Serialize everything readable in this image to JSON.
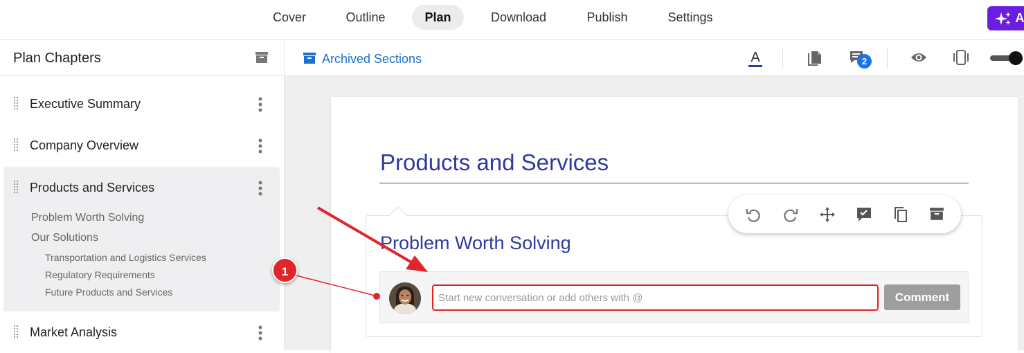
{
  "topnav": {
    "tabs": [
      {
        "label": "Cover",
        "active": false
      },
      {
        "label": "Outline",
        "active": false
      },
      {
        "label": "Plan",
        "active": true
      },
      {
        "label": "Download",
        "active": false
      },
      {
        "label": "Publish",
        "active": false
      },
      {
        "label": "Settings",
        "active": false
      }
    ],
    "ai_button_label": "A",
    "ai_button_icon": "sparkles-icon",
    "ai_button_color": "#6a1fe0"
  },
  "sidebar": {
    "title": "Plan Chapters",
    "chapters": [
      {
        "label": "Executive Summary",
        "active": false
      },
      {
        "label": "Company Overview",
        "active": false
      },
      {
        "label": "Products and Services",
        "active": true,
        "sections": [
          "Problem Worth Solving",
          "Our Solutions"
        ],
        "subsections": [
          "Transportation and Logistics Services",
          "Regulatory Requirements",
          "Future Products and Services"
        ]
      },
      {
        "label": "Market Analysis",
        "active": false
      }
    ]
  },
  "toolbar": {
    "archived_sections_label": "Archived Sections",
    "comments_badge": "2",
    "icons": [
      "text-color-icon",
      "pages-icon",
      "comments-icon",
      "preview-eye-icon",
      "mobile-view-icon",
      "toggle-switch"
    ],
    "accent_color": "#1a6fd1"
  },
  "document": {
    "title": "Products and Services",
    "section_title": "Problem Worth Solving",
    "comment_placeholder": "Start new conversation or add others with @",
    "comment_value": "",
    "comment_button": "Comment",
    "heading_color": "#2f3a9e"
  },
  "annotation": {
    "step_number": "1",
    "color": "#e0252b"
  }
}
